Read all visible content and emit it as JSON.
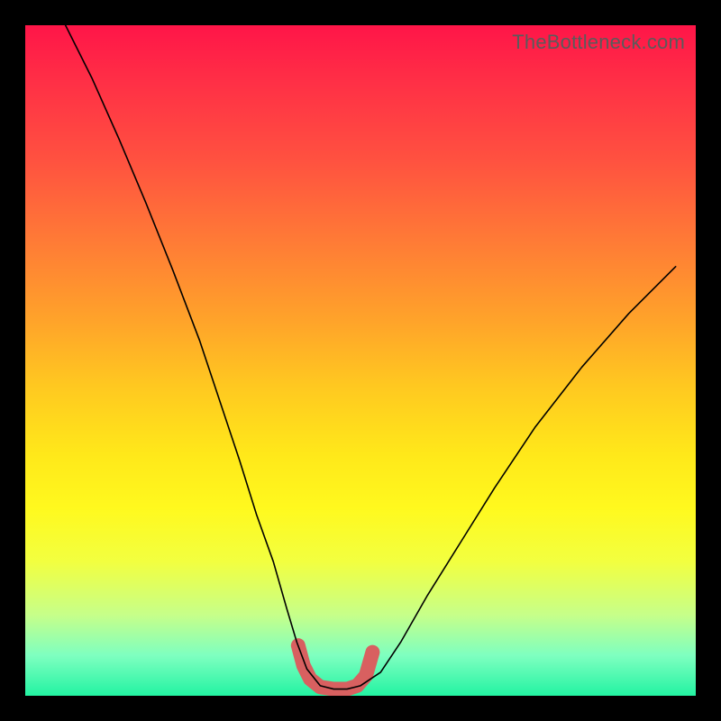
{
  "watermark": "TheBottleneck.com",
  "chart_data": {
    "type": "line",
    "title": "",
    "xlabel": "",
    "ylabel": "",
    "xlim": [
      0,
      100
    ],
    "ylim": [
      0,
      100
    ],
    "series": [
      {
        "name": "curve",
        "color": "#000000",
        "x": [
          6,
          10,
          14,
          18,
          22,
          26,
          29,
          32,
          34.5,
          37,
          39,
          40.5,
          42,
          44,
          46,
          48,
          50,
          53,
          56,
          60,
          65,
          70,
          76,
          83,
          90,
          97
        ],
        "y": [
          100,
          92,
          83,
          73.5,
          63.5,
          53,
          44,
          35,
          27,
          20,
          13,
          8,
          4,
          1.5,
          1,
          1,
          1.5,
          3.5,
          8,
          15,
          23,
          31,
          40,
          49,
          57,
          64
        ]
      },
      {
        "name": "highlight-band",
        "color": "#d86060",
        "x": [
          40.7,
          41.5,
          42.5,
          44,
          46,
          48,
          49.5,
          50.8,
          51.8
        ],
        "y": [
          7.5,
          4.5,
          2.5,
          1.3,
          1,
          1,
          1.5,
          3,
          6.5
        ]
      }
    ],
    "annotations": []
  }
}
